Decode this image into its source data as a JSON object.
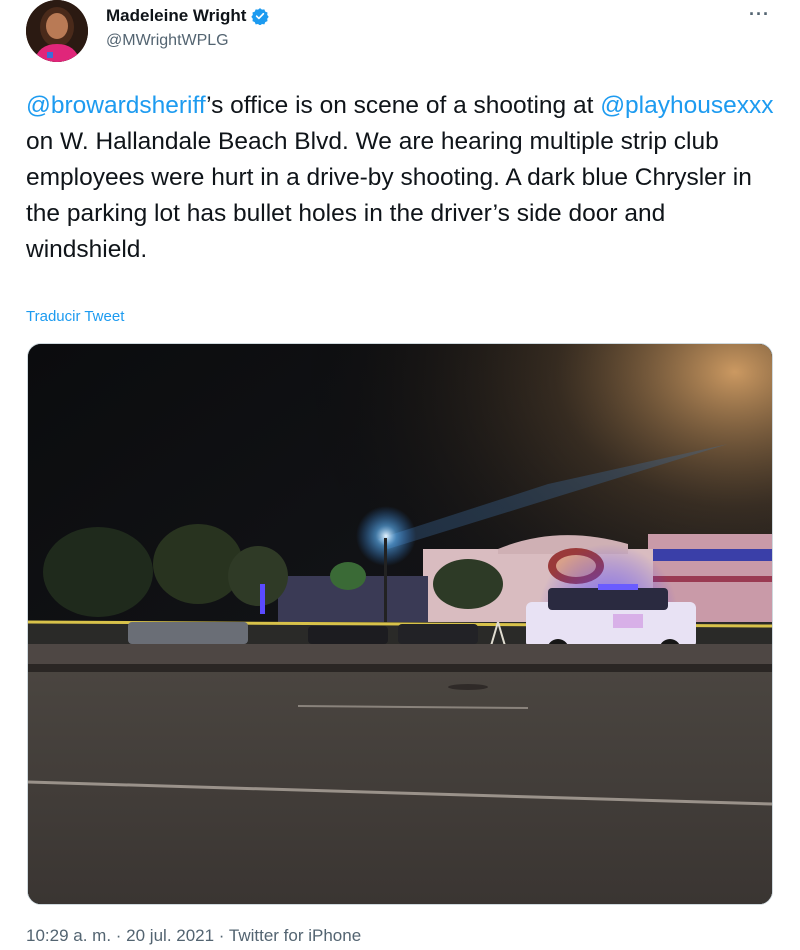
{
  "author": {
    "name": "Madeleine Wright",
    "handle": "@MWrightWPLG",
    "verified_icon": "verified-badge-icon",
    "accent_color": "#1d9bf0"
  },
  "tweet": {
    "mention_1": "@browardsheriff",
    "text_1": "’s office is on scene of a shooting at ",
    "mention_2": "@playhousexxx",
    "text_2": " on W. Hallandale Beach Blvd. We are hearing multiple strip club employees were hurt in a drive-by shooting. A dark blue Chrysler in the parking lot has bullet holes in the driver’s side door and windshield."
  },
  "translate_label": "Traducir Tweet",
  "more_label": "···",
  "meta": {
    "time": "10:29 a. m.",
    "separator_1": " · ",
    "date": "20 jul. 2021",
    "separator_2": " · ",
    "source": "Twitter for iPhone"
  }
}
